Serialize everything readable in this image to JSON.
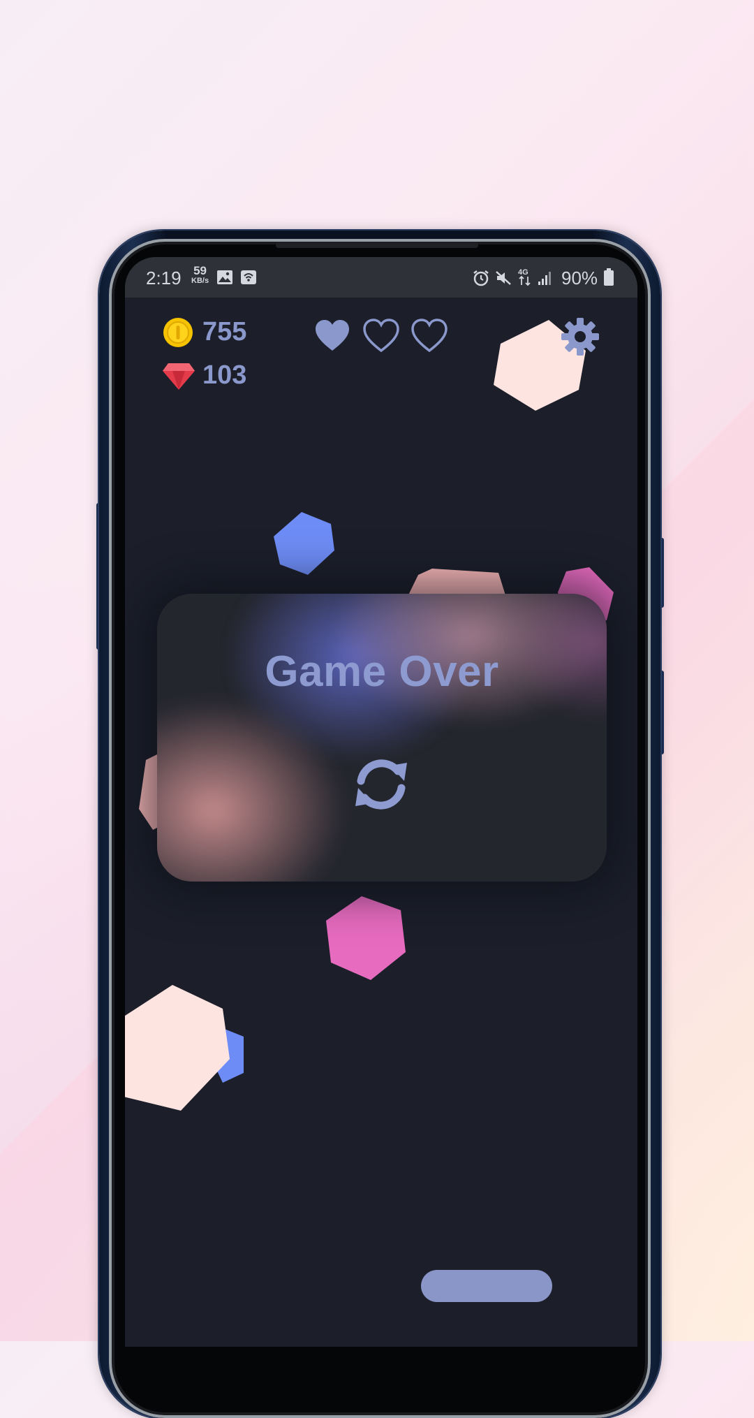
{
  "status_bar": {
    "time": "2:19",
    "net_speed_value": "59",
    "net_speed_unit": "KB/s",
    "left_icons": [
      "image-icon",
      "cast-icon"
    ],
    "right_icons": [
      "alarm-icon",
      "mute-icon",
      "4g-icon",
      "signal-icon",
      "battery-icon"
    ],
    "network_type": "4G",
    "battery": "90%"
  },
  "hud": {
    "coins": "755",
    "gems": "103",
    "lives_total": 3,
    "lives_remaining": 1,
    "icons": [
      "coin-icon",
      "gem-icon",
      "heart-icon",
      "gear-icon"
    ]
  },
  "dialog": {
    "title": "Game Over",
    "restart_icon": "refresh-icon"
  },
  "colors": {
    "screen_bg": "#1c1f2a",
    "accent": "#8a98cc",
    "hex_cream": "#fde4e1",
    "hex_blue": "#6e8cf5",
    "hex_pink": "#e76bbf",
    "hex_peach": "#fdbbbb",
    "coin": "#f6c300",
    "gem": "#e33b4a"
  }
}
